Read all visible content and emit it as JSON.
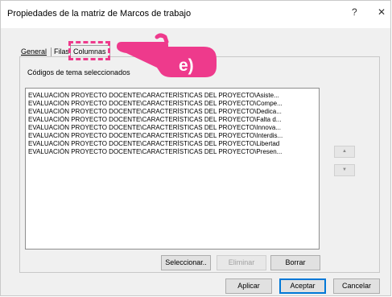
{
  "window": {
    "title": "Propiedades de la matriz de Marcos de trabajo",
    "help_label": "?",
    "close_label": "✕"
  },
  "tabs": [
    {
      "label": "General"
    },
    {
      "label": "Filas"
    },
    {
      "label": "Columnas",
      "active": true
    }
  ],
  "section_label": "Códigos de tema seleccionados",
  "codes": [
    "EVALUACIÓN PROYECTO DOCENTE\\CARACTERÍSTICAS DEL PROYECTO\\Asiste...",
    "EVALUACIÓN PROYECTO DOCENTE\\CARACTERÍSTICAS DEL PROYECTO\\Compe...",
    "EVALUACIÓN PROYECTO DOCENTE\\CARACTERÍSTICAS DEL PROYECTO\\Dedica...",
    "EVALUACIÓN PROYECTO DOCENTE\\CARACTERÍSTICAS DEL PROYECTO\\Falta d...",
    "EVALUACIÓN PROYECTO DOCENTE\\CARACTERÍSTICAS DEL PROYECTO\\Innova...",
    "EVALUACIÓN PROYECTO DOCENTE\\CARACTERÍSTICAS DEL PROYECTO\\Interdis...",
    "EVALUACIÓN PROYECTO DOCENTE\\CARACTERÍSTICAS DEL PROYECTO\\Libertad",
    "EVALUACIÓN PROYECTO DOCENTE\\CARACTERÍSTICAS DEL PROYECTO\\Presen..."
  ],
  "move_buttons": {
    "up_icon": "▲",
    "down_icon": "▼"
  },
  "list_actions": {
    "select": "Seleccionar..",
    "remove": "Eliminar",
    "clear": "Borrar"
  },
  "dialog_actions": {
    "apply": "Aplicar",
    "accept": "Aceptar",
    "cancel": "Cancelar"
  },
  "annotation": {
    "label": "e)",
    "color": "#ee3a8c"
  }
}
